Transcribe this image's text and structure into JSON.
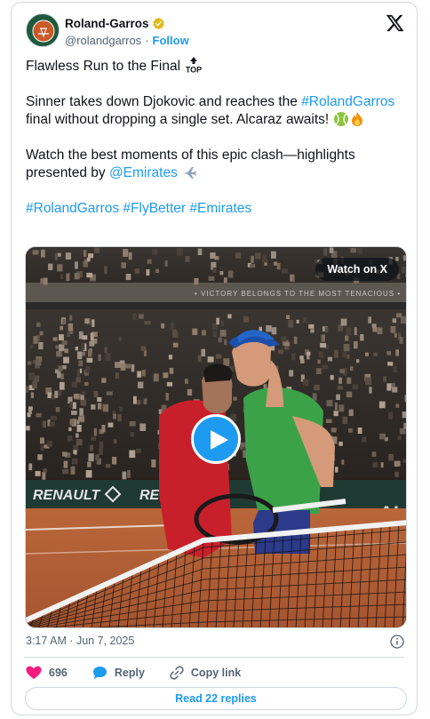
{
  "author": {
    "display_name": "Roland-Garros",
    "handle": "@rolandgarros",
    "follow_label": "Follow",
    "verified_color": "#e2b719"
  },
  "tweet": {
    "line1": "Flawless Run to the Final",
    "line2_a": "Sinner takes down Djokovic and reaches the",
    "hashtag_rg": "#RolandGarros",
    "line2_b": " final without dropping a single set. Alcaraz awaits!",
    "line3_a": "Watch the best moments of this epic clash—highlights presented by ",
    "mention": "@Emirates",
    "tags": [
      "#RolandGarros",
      "#FlyBetter",
      "#Emirates"
    ]
  },
  "media": {
    "watch_label": "Watch on X",
    "banner_text": "• VICTORY BELONGS TO THE MOST TENACIOUS •",
    "sponsor_1": "RENAULT",
    "sponsor_2": "RE",
    "sponsor_3": "AI"
  },
  "meta": {
    "timestamp": "3:17 AM · Jun 7, 2025"
  },
  "actions": {
    "like_count": "696",
    "reply_label": "Reply",
    "copy_label": "Copy link"
  },
  "read_replies_label": "Read 22 replies",
  "colors": {
    "link": "#1d9bf0",
    "like": "#f91880",
    "border": "#cfd9de"
  }
}
